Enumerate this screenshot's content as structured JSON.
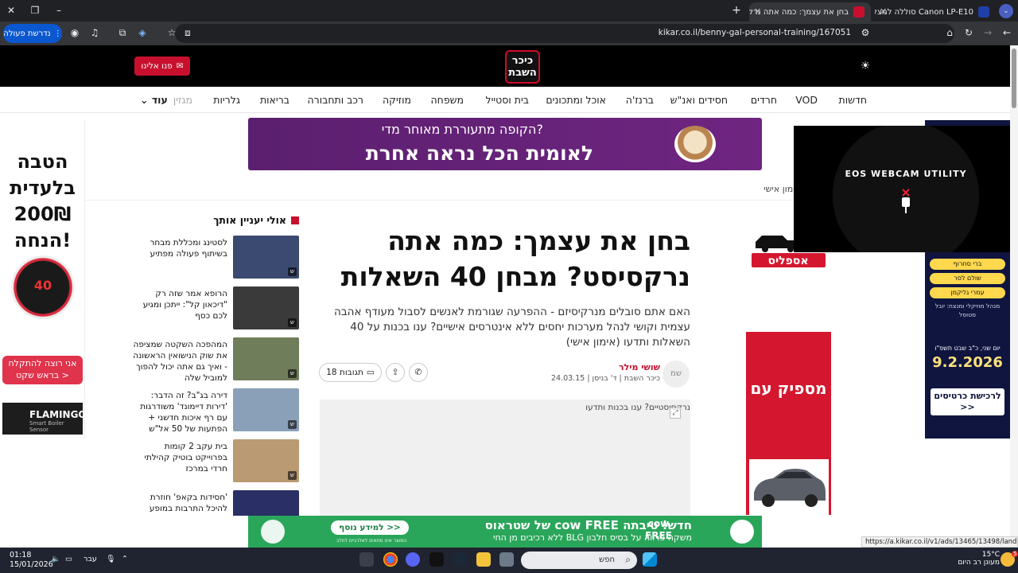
{
  "browser": {
    "tabs": [
      {
        "title": "בחן את עצמך: כמה אתה נרקסיסט?",
        "favicon_color": "#c8102e"
      },
      {
        "title": "Canon LP-E10 סוללה למצלמה",
        "favicon_color": "#1f3fa8"
      }
    ],
    "url": "kikar.co.il/benny-gal-personal-training/167051",
    "action_button_label": "נדרשת פעולה",
    "status_url": "https://a.kikar.co.il/v1/ads/13465/13498/landing-page"
  },
  "header": {
    "logo_line1": "כיכר",
    "logo_line2": "השבת",
    "contact_label": "פנו אלינו",
    "brand_red": "#c8102e"
  },
  "nav": {
    "items": [
      "חדשות",
      "VOD",
      "חרדים",
      "חסידים ואנ\"ש",
      "ברנז'ה",
      "אוכל ומתכונים",
      "בית וסטייל",
      "משפחה",
      "מוזיקה",
      "רכב ותחבורה",
      "בריאות",
      "גלריות",
      "מגזין"
    ],
    "more_label": "עוד"
  },
  "top_banner": {
    "line1": "הקופה מתעוררת מאוחר מדי?",
    "line2": "לאומית הכל נראה אחרת"
  },
  "left_ad": {
    "headline": "הטבה בלעדית 200₪ הנחה!",
    "dial_value": "40",
    "cta": "אני רוצה להתקלח בראש שקט >",
    "brand": "FLAMINGO",
    "brand_sub": "Smart Boiler Sensor"
  },
  "breadcrumb": "אימון אישי",
  "webcam": {
    "title": "EOS WEBCAM UTILITY"
  },
  "sidebar_ads": {
    "logo_text": "אספליס",
    "red_ad_text": "מספיק עם"
  },
  "right_ad": {
    "pills": [
      "ברי סחרוף",
      "שולם לסר",
      "עמרי גליקמן"
    ],
    "credits": "מנהל מוזיקלי ומנצח: יובל סטוסל",
    "venue": "יום שני, כ\"ב שבט תשפ\"ו",
    "date": "9.2.2026",
    "cta": "לרכישת כרטיסים >>"
  },
  "recommended": {
    "title": "אולי יעניין אותך",
    "items": [
      {
        "text": "לסטינג ומכללת מבחר בשיתוף פעולה מפתיע",
        "thumb_color": "#3b4a70"
      },
      {
        "text": "הרופא אמר שזה רק \"דיכאון קל\": ייתכן ומגיע לכם כסף",
        "thumb_color": "#3a3a3a"
      },
      {
        "text": "המהפכה השקטה שמציפה את שוק הנישואין הראשונה - ואיך גם אתה יכול להפוך למוביל שלה",
        "thumb_color": "#6f7d5a"
      },
      {
        "text": "דירה בג\"ב? זה הדבר: 'דירות דיימונד' משודרגות עם רף איכות חדשני + הפתעות של 50 אל\"ש",
        "thumb_color": "#8aa0b8"
      },
      {
        "text": "בית עקב 2 קומות בפרוייקט בוטיק קהילתי חרדי במרכז",
        "thumb_color": "#b99a72"
      },
      {
        "text": "'חסידות בקאפ' חוזרת להיכל התרבות במופע הוקרה לאהרן",
        "thumb_color": "#2a2f66"
      }
    ]
  },
  "article": {
    "title": "בחן את עצמך: כמה אתה נרקסיסט? מבחן 40 השאלות",
    "subtitle": "האם אתם סובלים מנרקיסיזם - ההפרעה שגורמת לאנשים לסבול מעודף אהבה עצמית וקושי לנהל מערכות יחסים ללא אינטרסים אישיים? ענו בכנות על 40 השאלות ותדעו (אימון אישי)",
    "author": "שושי מילר",
    "avatar_initials": "שמ",
    "meta": "כיכר השבת | ד' בניסן | 24.03.15",
    "comments_label": "18 תגובות",
    "image_alt": "נרקסיסטיים? ענו בכנות ותדעו"
  },
  "bottom_banner": {
    "main": "חדש! טיבתה cow FREE של שטראוס",
    "sub": "משקה פרווה על בסיס חלבון BLG ללא רכיבים מן החי",
    "cta": "למידע נוסף >>",
    "cta_note": "המוצר אינו מתאים לאלרגיים לחלב",
    "cow_text": "cow FREE"
  },
  "taskbar": {
    "time": "01:18",
    "date": "15/01/2026",
    "search_placeholder": "חפש",
    "lang": "עבר",
    "weather_temp": "15°C",
    "weather_desc": "מעונן רב היום",
    "notif_count": "5"
  }
}
